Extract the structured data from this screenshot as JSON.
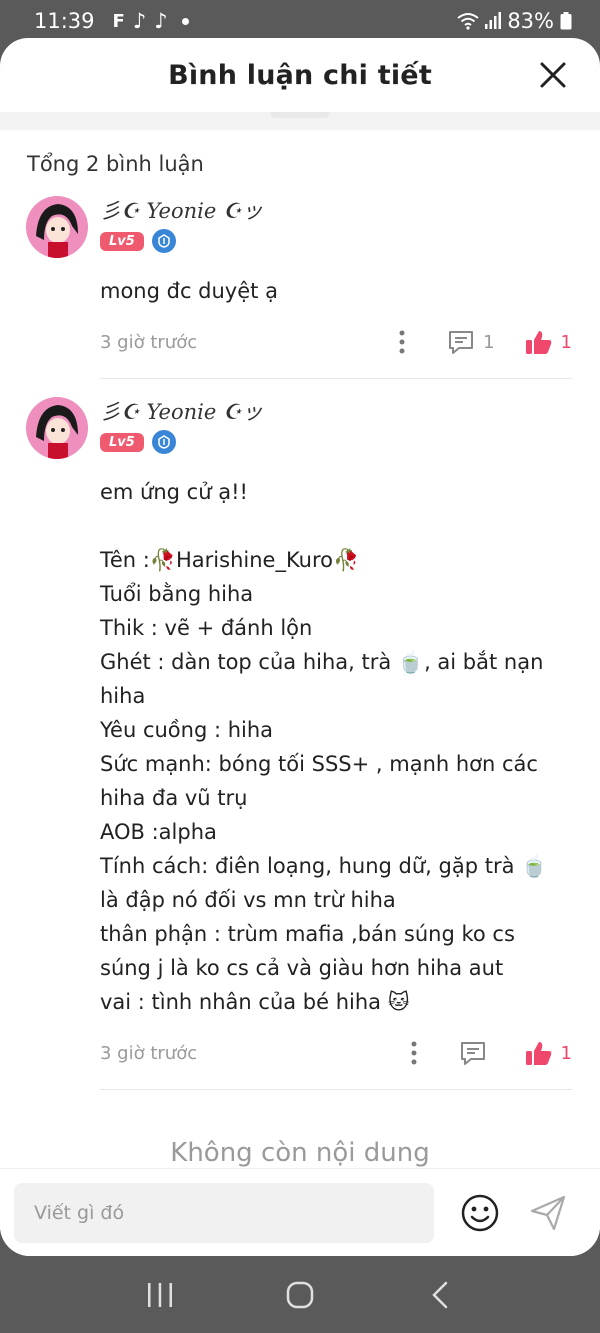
{
  "status_bar": {
    "time": "11:39",
    "battery": "83%",
    "icons": [
      "facebook-icon",
      "tiktok-icon",
      "tiktok-icon",
      "wifi-icon",
      "signal-icon",
      "battery-icon"
    ]
  },
  "sheet": {
    "title": "Bình luận chi tiết",
    "total_label": "Tổng 2 bình luận",
    "end_label": "Không còn nội dung"
  },
  "comments": [
    {
      "username": "彡☪ Yeonie ☪ッ",
      "level": "Lv5",
      "text": "mong đc duyệt ạ",
      "time": "3 giờ trước",
      "reply_count": "1",
      "like_count": "1"
    },
    {
      "username": "彡☪ Yeonie ☪ッ",
      "level": "Lv5",
      "text": "em ứng cử ạ!!\n\nTên :🥀Harishine_Kuro🥀\nTuổi bằng hiha\nThik : vẽ + đánh lộn\nGhét : dàn top của hiha, trà 🍵, ai bắt nạn hiha\nYêu cuồng : hiha\nSức mạnh: bóng tối SSS+ , mạnh hơn các hiha đa vũ trụ\nAOB :alpha\nTính cách: điên loạng, hung dữ, gặp trà 🍵 là đập nó đối vs mn trừ hiha\nthân phận : trùm mafia ,bán súng ko cs súng j là ko cs cả và giàu hơn hiha aut\nvai : tình nhân của bé hiha 🐱",
      "time": "3 giờ trước",
      "reply_count": "",
      "like_count": "1"
    }
  ],
  "composer": {
    "placeholder": "Viết gì đó"
  },
  "colors": {
    "accent": "#f0476d",
    "level_badge": "#f05a6e",
    "muted": "#9a9a9a"
  }
}
